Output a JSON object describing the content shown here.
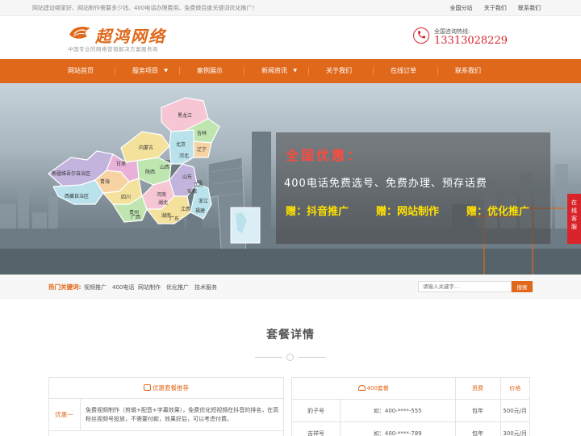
{
  "topbar": {
    "notice": "网站建设哪家好、网站制作需要多少钱、400电话办理费用、免费做百度关键词优化推广！",
    "links": [
      "全国分站",
      "关于我们",
      "联系我们"
    ]
  },
  "header": {
    "logo_text": "超鸿网络",
    "logo_sub": "中国专业的网络营销解决方案服务商",
    "hotline_label": "全国咨询热线:",
    "hotline_number": "13313028229"
  },
  "nav": {
    "items": [
      {
        "label": "网站首页"
      },
      {
        "label": "服务项目"
      },
      {
        "label": "案例展示"
      },
      {
        "label": "新闻资讯"
      },
      {
        "label": "关于我们"
      },
      {
        "label": "在线订单"
      },
      {
        "label": "联系我们"
      }
    ]
  },
  "banner": {
    "promo_title": "全国优惠：",
    "promo_line": "400电话免费选号、免费办理、预存话费",
    "gifts": [
      "赠：抖音推广",
      "赠：网站制作",
      "赠：优化推广"
    ],
    "map_labels": [
      "新疆维吾尔自治区",
      "西藏自治区",
      "青海",
      "甘肃",
      "四川",
      "内蒙古",
      "黑龙江",
      "吉林",
      "辽宁",
      "北京",
      "河北",
      "山西",
      "陕西",
      "河南",
      "山东",
      "湖北",
      "湖南",
      "贵州",
      "广西",
      "广东",
      "江西",
      "浙江",
      "安徽",
      "江苏",
      "福建"
    ]
  },
  "side_service": {
    "label": "在线客服"
  },
  "hotbar": {
    "label": "热门关键词:",
    "keywords": [
      "视频推广",
      "400电话",
      "网站制作",
      "优化推广",
      "技术服务"
    ],
    "search_placeholder": "请输入关键字...",
    "search_button": "搜索"
  },
  "section": {
    "title": "套餐详情"
  },
  "left_panel": {
    "header": "优惠套餐推荐",
    "rows": [
      {
        "label": "优惠一",
        "text": "免费视频制作（剪辑+配音+字幕效果），免费优化短视频在抖音的排名，在高粉丝视频号投放，不需要付款，效果好后，可以考虑付费。"
      }
    ]
  },
  "right_table": {
    "headers": [
      "400套餐",
      "资费",
      "价格"
    ],
    "rows": [
      [
        "豹子号",
        "如：400-****-555",
        "包年",
        "500元/月"
      ],
      [
        "吉祥号",
        "如：400-****-789",
        "包年",
        "300元/月"
      ]
    ]
  },
  "colors": {
    "brand_orange": "#e0681b",
    "hotline_red": "#d9232b",
    "promo_red": "#ff4a3d",
    "promo_yellow": "#ffe000"
  }
}
